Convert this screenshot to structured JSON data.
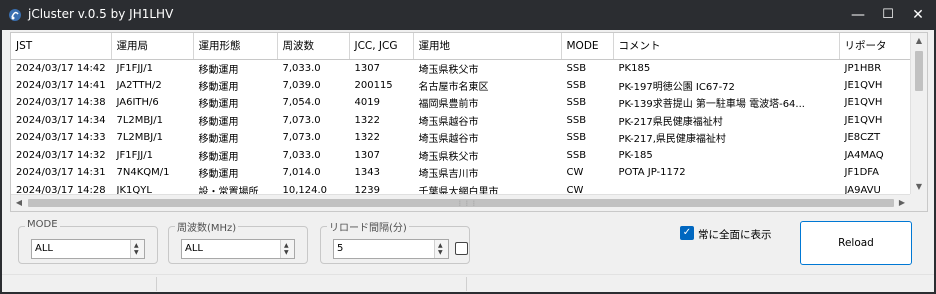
{
  "window": {
    "title": "jCluster v.0.5 by JH1LHV",
    "minimize": "—",
    "maximize": "☐",
    "close": "✕"
  },
  "table": {
    "columns": [
      "JST",
      "運用局",
      "運用形態",
      "周波数",
      "JCC, JCG",
      "運用地",
      "MODE",
      "コメント",
      "リポータ"
    ],
    "rows": [
      [
        "2024/03/17 14:42",
        "JF1FJJ/1",
        "移動運用",
        "7,033.0",
        "1307",
        "埼玉県秩父市",
        "SSB",
        "PK185",
        "JP1HBR"
      ],
      [
        "2024/03/17 14:41",
        "JA2TTH/2",
        "移動運用",
        "7,039.0",
        "200115",
        "名古屋市名東区",
        "SSB",
        "PK-197明徳公園 IC67-72",
        "JE1QVH"
      ],
      [
        "2024/03/17 14:38",
        "JA6ITH/6",
        "移動運用",
        "7,054.0",
        "4019",
        "福岡県豊前市",
        "SSB",
        "PK-139求菩提山 第一駐車場 電波塔-64...",
        "JE1QVH"
      ],
      [
        "2024/03/17 14:34",
        "7L2MBJ/1",
        "移動運用",
        "7,073.0",
        "1322",
        "埼玉県越谷市",
        "SSB",
        "PK-217県民健康福祉村",
        "JE1QVH"
      ],
      [
        "2024/03/17 14:33",
        "7L2MBJ/1",
        "移動運用",
        "7,073.0",
        "1322",
        "埼玉県越谷市",
        "SSB",
        "PK-217,県民健康福祉村",
        "JE8CZT"
      ],
      [
        "2024/03/17 14:32",
        "JF1FJJ/1",
        "移動運用",
        "7,033.0",
        "1307",
        "埼玉県秩父市",
        "SSB",
        "PK-185",
        "JA4MAQ"
      ],
      [
        "2024/03/17 14:31",
        "7N4KQM/1",
        "移動運用",
        "7,014.0",
        "1343",
        "埼玉県吉川市",
        "CW",
        "POTA JP-1172",
        "JF1DFA"
      ],
      [
        "2024/03/17 14:28",
        "JK1QYL",
        "設・常置場所",
        "10,124.0",
        "1239",
        "千葉県大網白里市",
        "CW",
        "",
        "JA9AVU"
      ]
    ]
  },
  "controls": {
    "mode": {
      "label": "MODE",
      "value": "ALL"
    },
    "freq": {
      "label": "周波数(MHz)",
      "value": "ALL"
    },
    "reload_interval": {
      "label": "リロード間隔(分)",
      "value": "5"
    },
    "always_on_top": {
      "label": "常に全面に表示",
      "checked": true
    },
    "reload_button": "Reload"
  },
  "colors": {
    "titlebar": "#2b2d31",
    "panel": "#f0f0f0",
    "accent": "#0078d4"
  }
}
